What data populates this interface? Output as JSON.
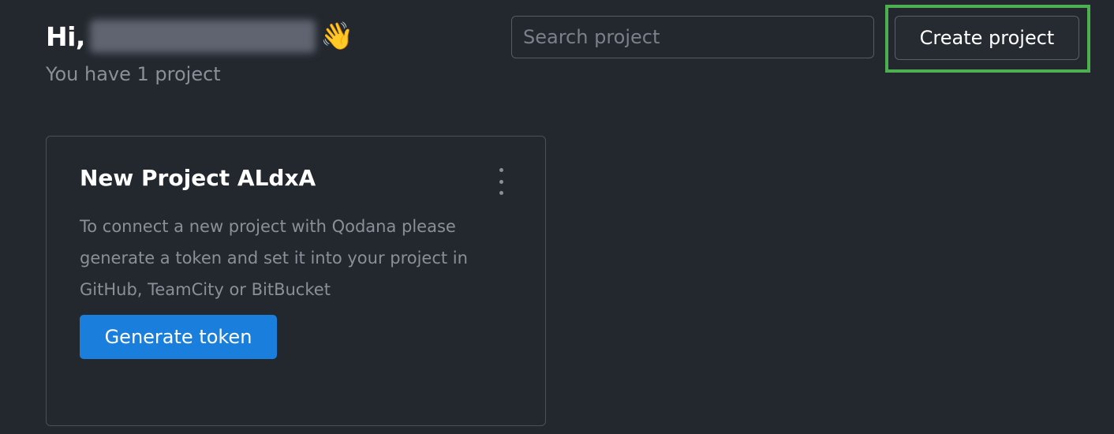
{
  "header": {
    "greeting": "Hi,",
    "user_name": "",
    "wave_emoji": "👋",
    "project_count_text": "You have 1 project"
  },
  "search": {
    "placeholder": "Search project",
    "value": ""
  },
  "toolbar": {
    "create_label": "Create project",
    "highlight_color": "#4caf50"
  },
  "projects": [
    {
      "title": "New Project ALdxA",
      "description": "To connect a new project with Qodana please generate a token and set it into your project in GitHub, TeamCity or BitBucket",
      "action_label": "Generate token",
      "menu_icon": "more-vertical-icon"
    }
  ],
  "colors": {
    "background": "#23272e",
    "primary_button": "#1a7fdc",
    "muted_text": "#8a8f98"
  }
}
